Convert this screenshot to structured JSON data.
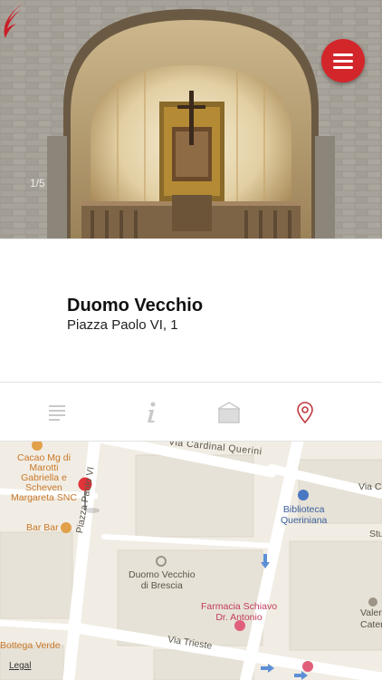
{
  "hero": {
    "photo_counter": "1/5",
    "menu_icon": "hamburger-menu-icon",
    "logo_icon": "wing-logo-icon"
  },
  "place": {
    "name": "Duomo Vecchio",
    "address": "Piazza Paolo VI, 1"
  },
  "tabs": [
    {
      "icon": "text-lines-icon"
    },
    {
      "icon": "info-icon"
    },
    {
      "icon": "gallery-icon"
    },
    {
      "icon": "location-pin-icon",
      "active": true
    }
  ],
  "map": {
    "streets": {
      "cardinal_querini": "Via Cardinal Querini",
      "paolo_vi": "Piazza Paolo VI",
      "trieste": "Via Trieste",
      "via_ca": "Via Ca",
      "stu": "Stu",
      "valeri": "Valeri",
      "cater": "Cater"
    },
    "pois": {
      "cacao_line1": "Cacao Mg di",
      "cacao_line2": "Marotti",
      "cacao_line3": "Gabriella e",
      "cacao_line4": "Scheven",
      "cacao_line5": "Margareta SNC",
      "bar_bar": "Bar Bar",
      "bottega_verde": "Bottega Verde",
      "biblioteca_line1": "Biblioteca",
      "biblioteca_line2": "Queriniana",
      "duomo_line1": "Duomo Vecchio",
      "duomo_line2": "di Brescia",
      "farmacia_line1": "Farmacia Schiavo",
      "farmacia_line2": "Dr. Antonio"
    },
    "legal": "Legal"
  },
  "colors": {
    "accent": "#d3262b",
    "map_bg": "#f1ede4",
    "road": "#ffffff"
  }
}
